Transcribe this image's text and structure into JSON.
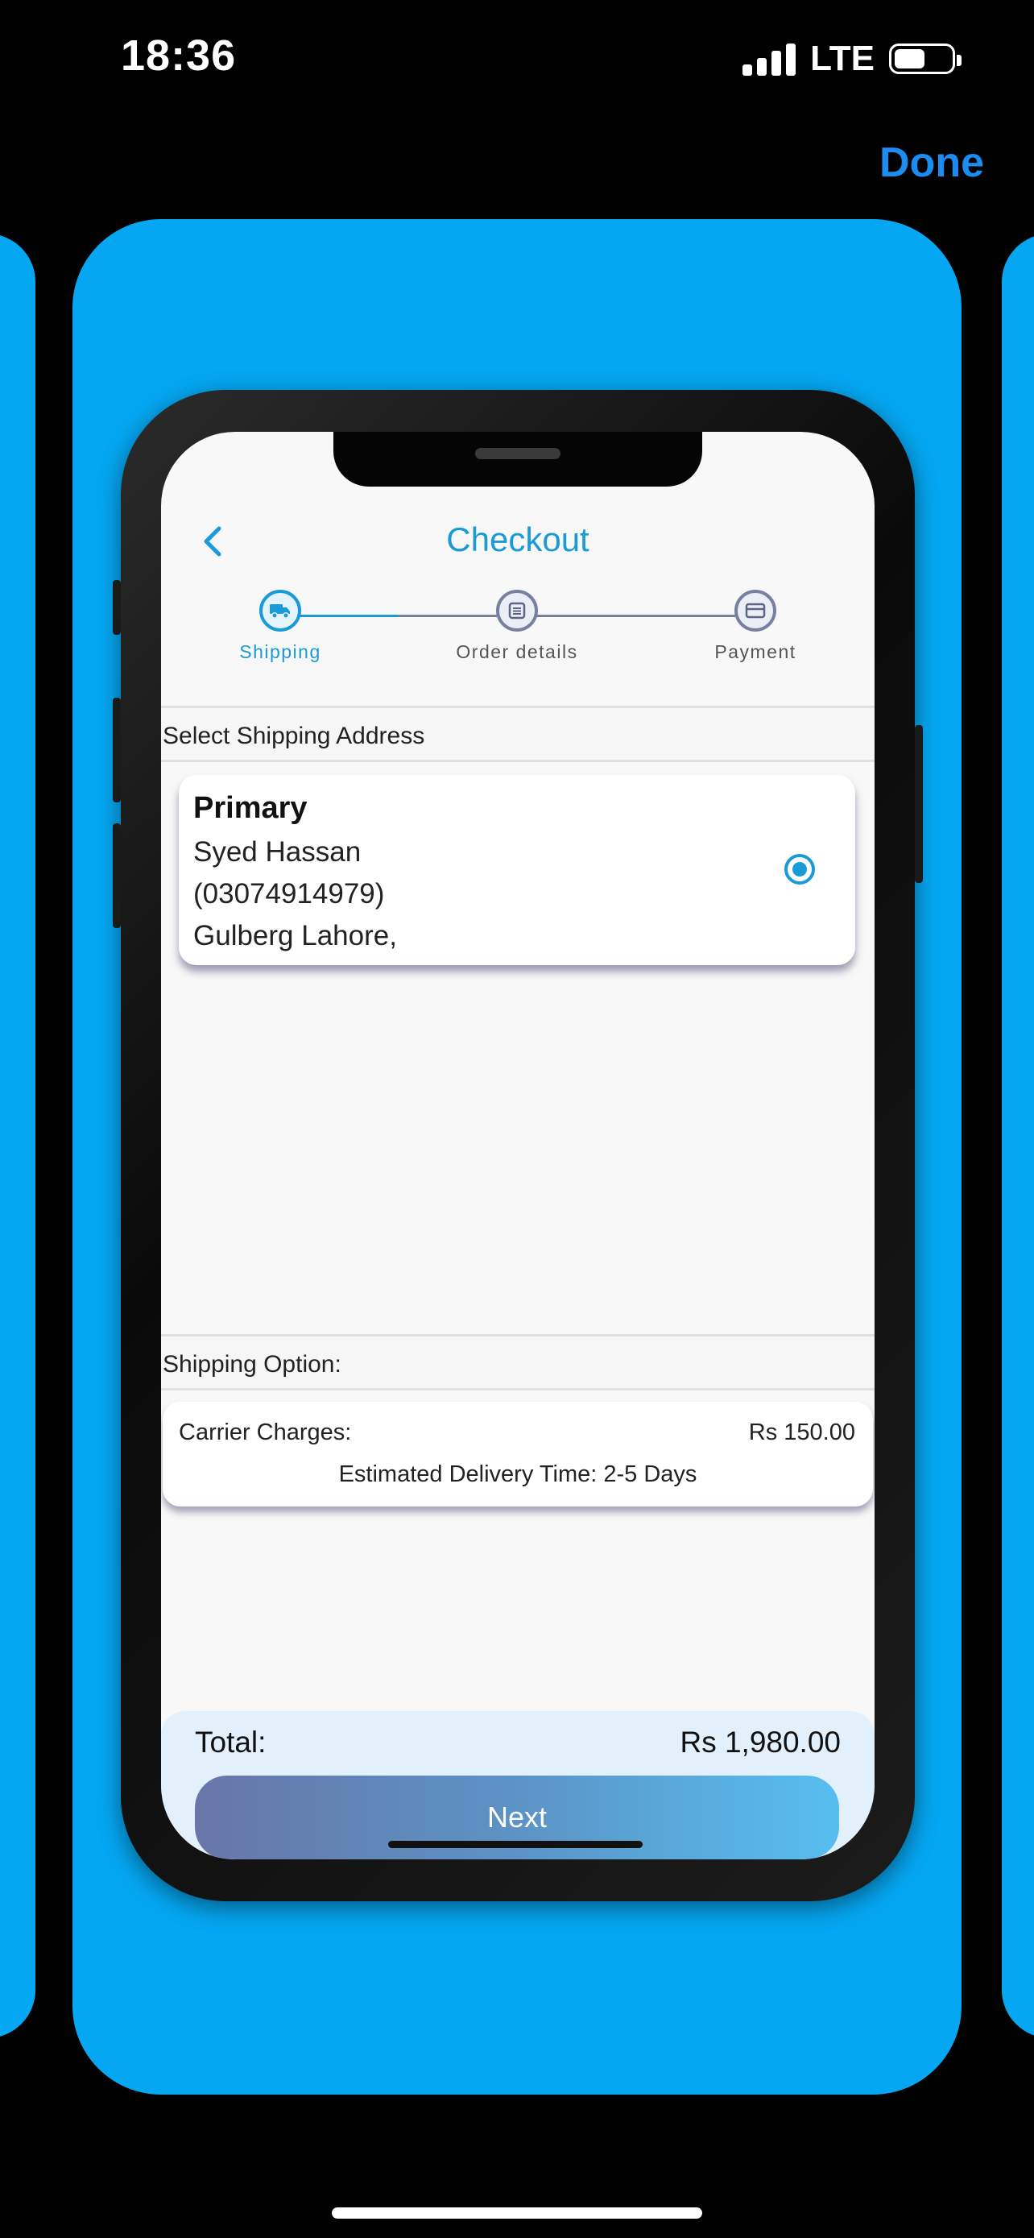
{
  "status_bar": {
    "time": "18:36",
    "network": "LTE"
  },
  "toolbar": {
    "done_label": "Done"
  },
  "checkout": {
    "title": "Checkout",
    "steps": [
      {
        "label": "Shipping",
        "icon": "truck-icon",
        "active": true
      },
      {
        "label": "Order details",
        "icon": "list-icon",
        "active": false
      },
      {
        "label": "Payment",
        "icon": "card-icon",
        "active": false
      }
    ],
    "address_section_title": "Select Shipping Address",
    "address": {
      "title": "Primary",
      "name": "Syed Hassan",
      "phone": "(03074914979)",
      "location": "Gulberg Lahore,",
      "selected": true
    },
    "shipping_section_title": "Shipping Option:",
    "shipping": {
      "carrier_label": "Carrier Charges:",
      "carrier_value": "Rs 150.00",
      "delivery_text": "Estimated Delivery Time: 2-5 Days"
    },
    "total_label": "Total:",
    "total_value": "Rs 1,980.00",
    "next_label": "Next"
  },
  "colors": {
    "accent": "#1a9ad6",
    "card_background": "#05a7f2",
    "done": "#1a8cf2"
  }
}
